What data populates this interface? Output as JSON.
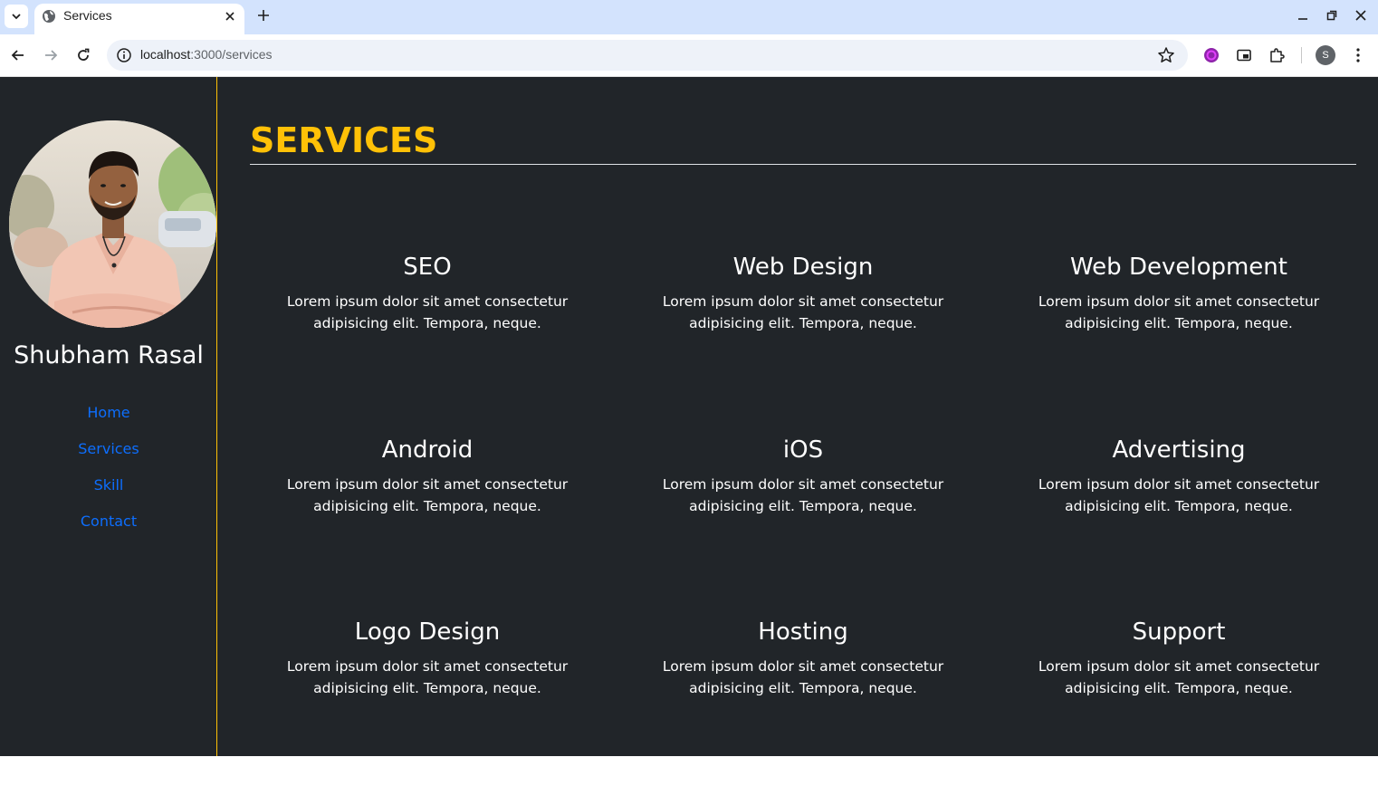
{
  "browser": {
    "tab_title": "Services",
    "url_host": "localhost",
    "url_path": ":3000/services",
    "profile_initial": "S",
    "icons": [
      "tab-search-icon",
      "globe-icon",
      "close-icon",
      "plus-icon",
      "minimize-icon",
      "restore-icon",
      "window-close-icon",
      "back-icon",
      "forward-icon",
      "reload-icon",
      "site-info-icon",
      "star-icon",
      "extension-icon",
      "picture-in-picture-icon",
      "puzzle-icon",
      "more-icon"
    ]
  },
  "sidebar": {
    "name": "Shubham Rasal",
    "nav": [
      {
        "label": "Home"
      },
      {
        "label": "Services"
      },
      {
        "label": "Skill"
      },
      {
        "label": "Contact"
      }
    ]
  },
  "main": {
    "title": "SERVICES",
    "services": [
      {
        "title": "SEO",
        "text": "Lorem ipsum dolor sit amet consectetur adipisicing elit. Tempora, neque."
      },
      {
        "title": "Web Design",
        "text": "Lorem ipsum dolor sit amet consectetur adipisicing elit. Tempora, neque."
      },
      {
        "title": "Web Development",
        "text": "Lorem ipsum dolor sit amet consectetur adipisicing elit. Tempora, neque."
      },
      {
        "title": "Android",
        "text": "Lorem ipsum dolor sit amet consectetur adipisicing elit. Tempora, neque."
      },
      {
        "title": "iOS",
        "text": "Lorem ipsum dolor sit amet consectetur adipisicing elit. Tempora, neque."
      },
      {
        "title": "Advertising",
        "text": "Lorem ipsum dolor sit amet consectetur adipisicing elit. Tempora, neque."
      },
      {
        "title": "Logo Design",
        "text": "Lorem ipsum dolor sit amet consectetur adipisicing elit. Tempora, neque."
      },
      {
        "title": "Hosting",
        "text": "Lorem ipsum dolor sit amet consectetur adipisicing elit. Tempora, neque."
      },
      {
        "title": "Support",
        "text": "Lorem ipsum dolor sit amet consectetur adipisicing elit. Tempora, neque."
      }
    ]
  },
  "colors": {
    "page_bg": "#212529",
    "accent": "#ffc107",
    "link": "#0d6efd",
    "text": "#ffffff"
  }
}
